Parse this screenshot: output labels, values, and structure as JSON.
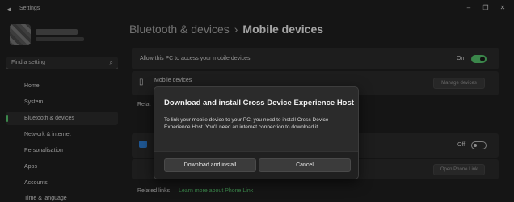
{
  "window": {
    "title": "Settings",
    "controls": {
      "minimize": "–",
      "maximize": "❐",
      "close": "✕"
    }
  },
  "sidebar": {
    "search_placeholder": "Find a setting",
    "items": [
      {
        "label": "Home"
      },
      {
        "label": "System"
      },
      {
        "label": "Bluetooth & devices",
        "active": true
      },
      {
        "label": "Network & internet"
      },
      {
        "label": "Personalisation"
      },
      {
        "label": "Apps"
      },
      {
        "label": "Accounts"
      },
      {
        "label": "Time & language"
      }
    ]
  },
  "breadcrumb": {
    "parent": "Bluetooth & devices",
    "separator": "›",
    "current": "Mobile devices"
  },
  "main": {
    "allow_access": {
      "label": "Allow this PC to access your mobile devices",
      "state": "On"
    },
    "mobile_devices": {
      "title": "Mobile devices",
      "button": "Manage devices"
    },
    "related_partial": "Relat",
    "phone_link": {
      "state": "Off",
      "button": "Open Phone Link"
    },
    "related_links": {
      "label": "Related links",
      "link": "Learn more about Phone Link"
    }
  },
  "dialog": {
    "title": "Download and install Cross Device Experience Host",
    "body": "To link your mobile device to your PC, you need to install Cross Device Experience Host. You'll need an internet connection to download it.",
    "primary_button": "Download and install",
    "secondary_button": "Cancel"
  },
  "colors": {
    "accent": "#57c86f",
    "background": "#202020",
    "card": "#2b2b2b",
    "link": "#57c86f"
  }
}
